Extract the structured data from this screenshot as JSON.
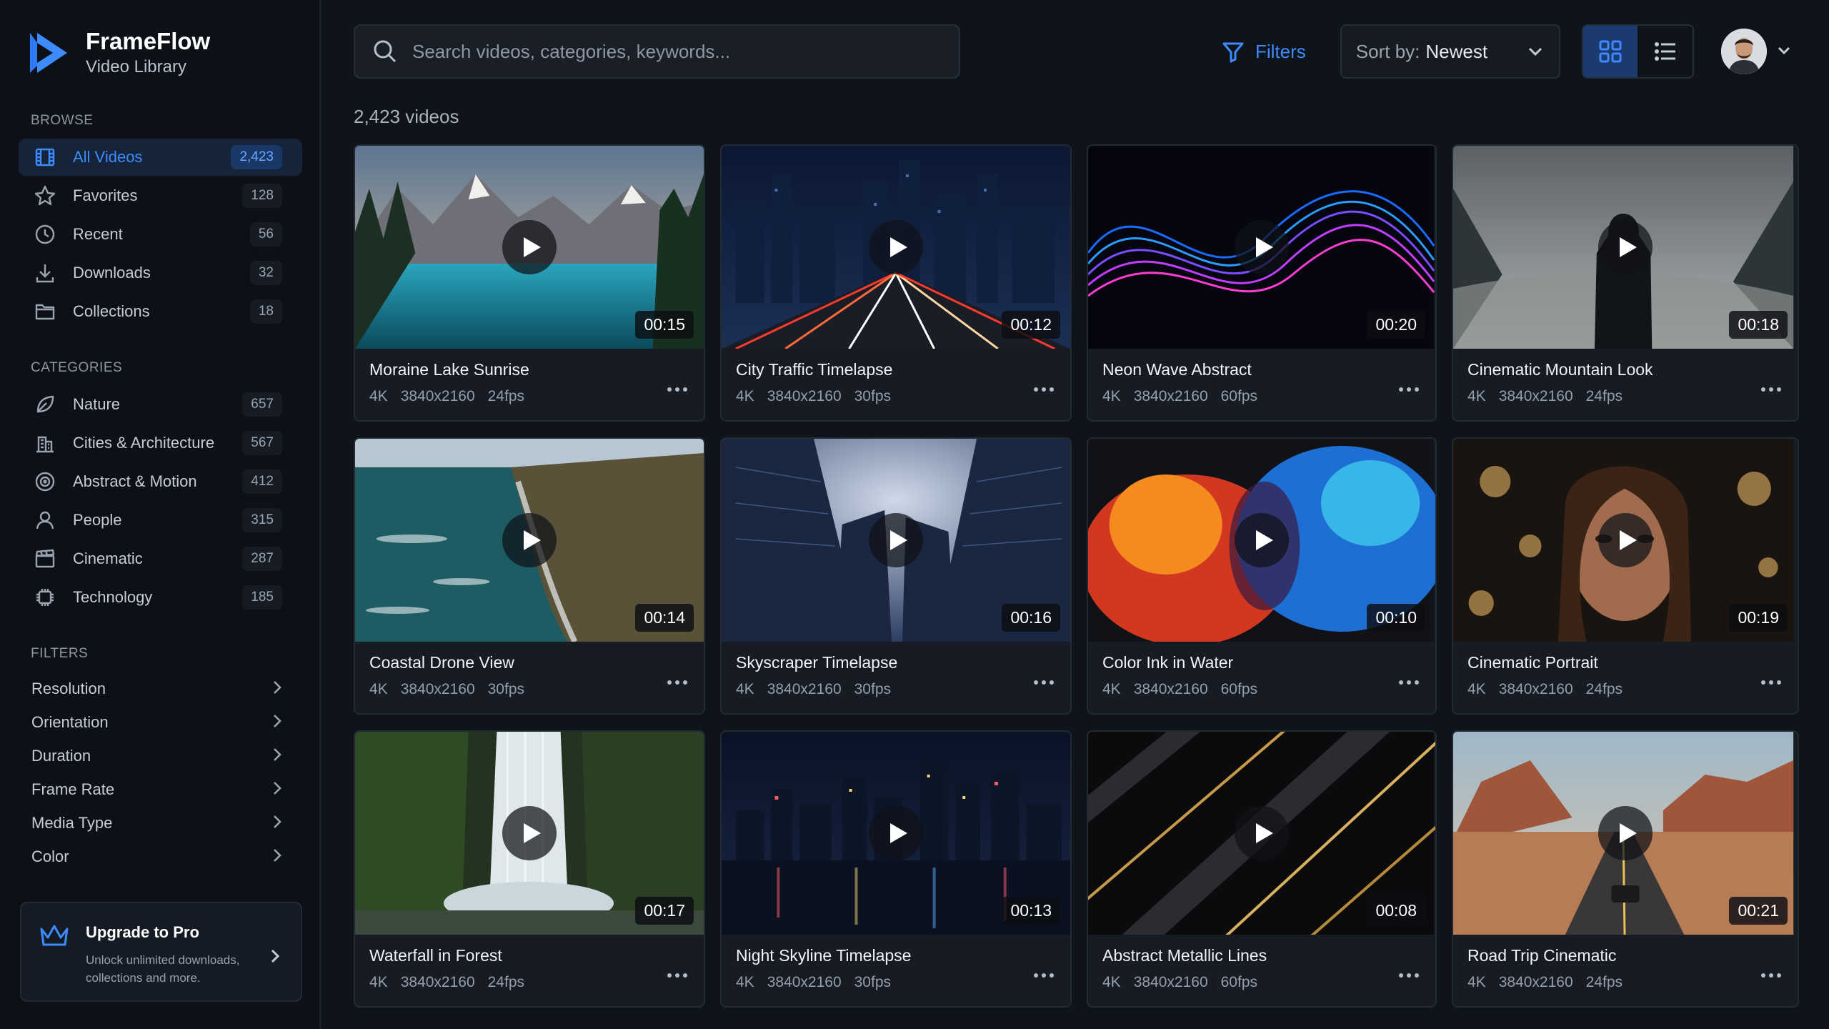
{
  "brand": {
    "name": "FrameFlow",
    "subtitle": "Video Library"
  },
  "sidebar": {
    "browse_title": "BROWSE",
    "browse": [
      {
        "label": "All Videos",
        "count": "2,423",
        "icon": "film-icon",
        "active": true
      },
      {
        "label": "Favorites",
        "count": "128",
        "icon": "star-icon"
      },
      {
        "label": "Recent",
        "count": "56",
        "icon": "clock-icon"
      },
      {
        "label": "Downloads",
        "count": "32",
        "icon": "download-icon"
      },
      {
        "label": "Collections",
        "count": "18",
        "icon": "folder-icon"
      }
    ],
    "categories_title": "CATEGORIES",
    "categories": [
      {
        "label": "Nature",
        "count": "657",
        "icon": "leaf-icon"
      },
      {
        "label": "Cities & Architecture",
        "count": "567",
        "icon": "building-icon"
      },
      {
        "label": "Abstract & Motion",
        "count": "412",
        "icon": "target-icon"
      },
      {
        "label": "People",
        "count": "315",
        "icon": "person-icon"
      },
      {
        "label": "Cinematic",
        "count": "287",
        "icon": "clapperboard-icon"
      },
      {
        "label": "Technology",
        "count": "185",
        "icon": "chip-icon"
      }
    ],
    "filters_title": "FILTERS",
    "filters": [
      "Resolution",
      "Orientation",
      "Duration",
      "Frame Rate",
      "Media Type",
      "Color"
    ],
    "upgrade": {
      "title": "Upgrade to Pro",
      "desc_line1": "Unlock unlimited downloads,",
      "desc_line2": "collections and more."
    }
  },
  "topbar": {
    "search_placeholder": "Search videos, categories, keywords...",
    "filters_label": "Filters",
    "sort_prefix": "Sort by:",
    "sort_value": "Newest"
  },
  "video_count": "2,423 videos",
  "videos": [
    {
      "title": "Moraine Lake Sunrise",
      "duration": "00:15",
      "res": "4K",
      "dims": "3840x2160",
      "fps": "24fps"
    },
    {
      "title": "City Traffic Timelapse",
      "duration": "00:12",
      "res": "4K",
      "dims": "3840x2160",
      "fps": "30fps"
    },
    {
      "title": "Neon Wave Abstract",
      "duration": "00:20",
      "res": "4K",
      "dims": "3840x2160",
      "fps": "60fps"
    },
    {
      "title": "Cinematic Mountain Look",
      "duration": "00:18",
      "res": "4K",
      "dims": "3840x2160",
      "fps": "24fps"
    },
    {
      "title": "Coastal Drone View",
      "duration": "00:14",
      "res": "4K",
      "dims": "3840x2160",
      "fps": "30fps"
    },
    {
      "title": "Skyscraper Timelapse",
      "duration": "00:16",
      "res": "4K",
      "dims": "3840x2160",
      "fps": "30fps"
    },
    {
      "title": "Color Ink in Water",
      "duration": "00:10",
      "res": "4K",
      "dims": "3840x2160",
      "fps": "60fps"
    },
    {
      "title": "Cinematic Portrait",
      "duration": "00:19",
      "res": "4K",
      "dims": "3840x2160",
      "fps": "24fps"
    },
    {
      "title": "Waterfall in Forest",
      "duration": "00:17",
      "res": "4K",
      "dims": "3840x2160",
      "fps": "24fps"
    },
    {
      "title": "Night Skyline Timelapse",
      "duration": "00:13",
      "res": "4K",
      "dims": "3840x2160",
      "fps": "30fps"
    },
    {
      "title": "Abstract Metallic Lines",
      "duration": "00:08",
      "res": "4K",
      "dims": "3840x2160",
      "fps": "60fps"
    },
    {
      "title": "Road Trip Cinematic",
      "duration": "00:21",
      "res": "4K",
      "dims": "3840x2160",
      "fps": "24fps"
    }
  ],
  "colors": {
    "accent": "#3d8bff",
    "background": "#0f131a",
    "card": "#171c24"
  }
}
